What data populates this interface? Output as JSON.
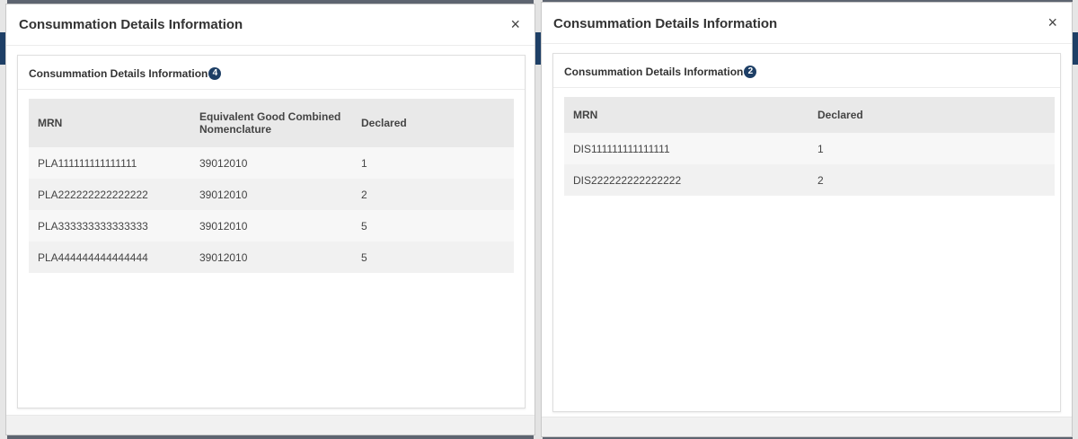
{
  "left_modal": {
    "title": "Consummation Details Information",
    "close_label": "×",
    "card_title": "Consummation Details Information",
    "badge_count": "4",
    "columns": [
      "MRN",
      "Equivalent Good Combined Nomenclature",
      "Declared"
    ],
    "rows": [
      [
        "PLA111111111111111",
        "39012010",
        "1"
      ],
      [
        "PLA222222222222222",
        "39012010",
        "2"
      ],
      [
        "PLA333333333333333",
        "39012010",
        "5"
      ],
      [
        "PLA444444444444444",
        "39012010",
        "5"
      ]
    ]
  },
  "right_modal": {
    "title": "Consummation Details Information",
    "close_label": "×",
    "card_title": "Consummation Details Information",
    "badge_count": "2",
    "columns": [
      "MRN",
      "Declared"
    ],
    "rows": [
      [
        "DIS111111111111111",
        "1"
      ],
      [
        "DIS222222222222222",
        "2"
      ]
    ]
  },
  "colors": {
    "badge": "#1e3f66",
    "header_row": "#e9e9e9"
  }
}
